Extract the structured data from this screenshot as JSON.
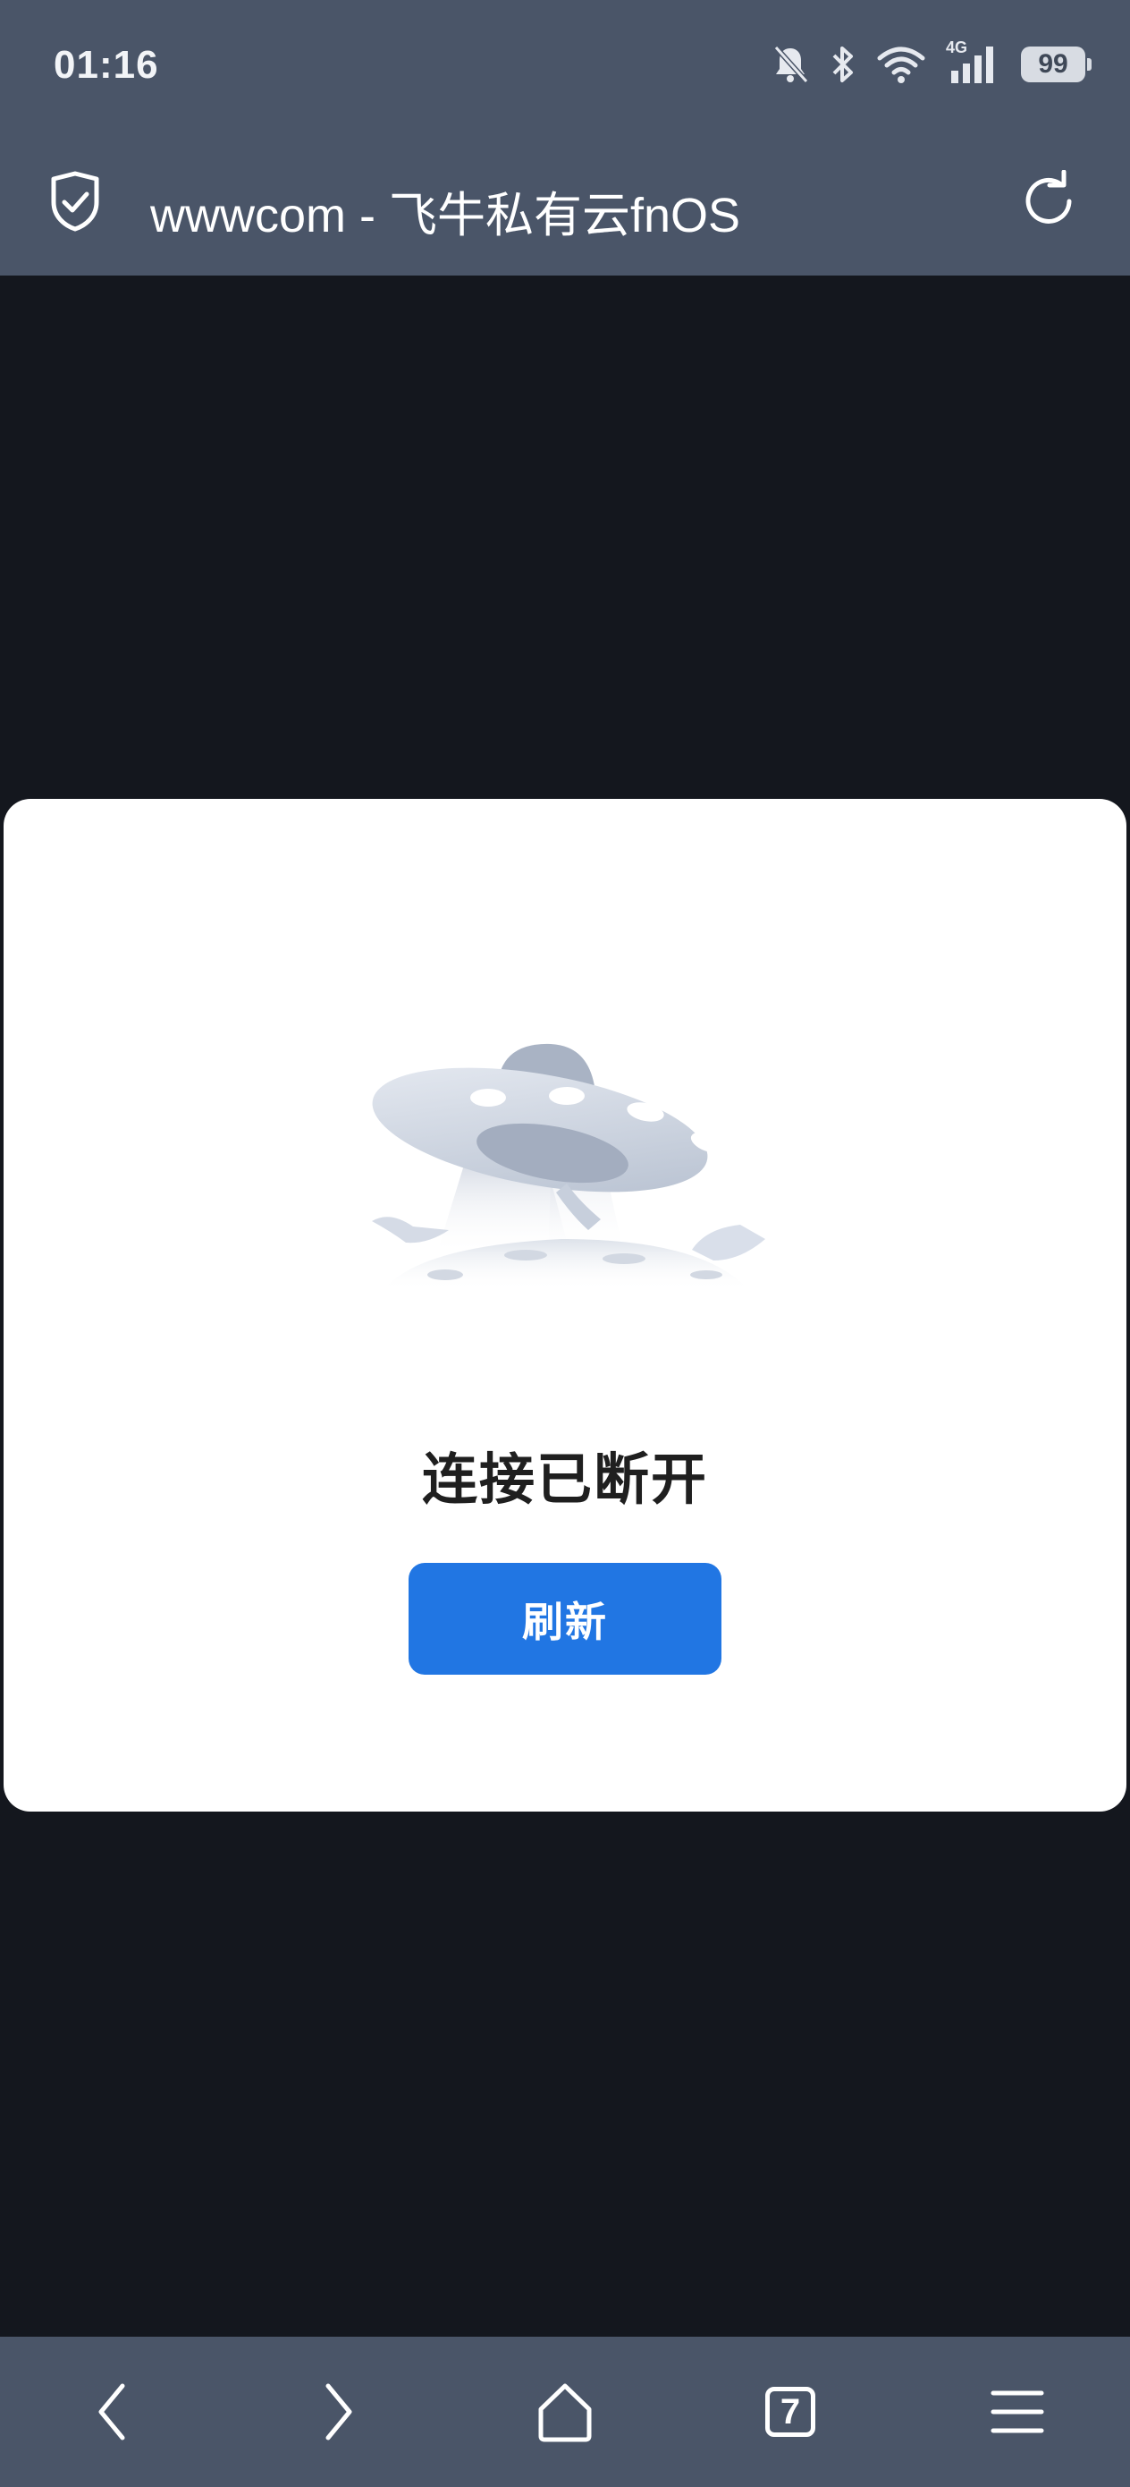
{
  "status_bar": {
    "time": "01:16",
    "network": "4G",
    "battery": "99",
    "icons": [
      "bell-off-icon",
      "bluetooth-icon",
      "wifi-icon",
      "signal-icon",
      "battery-icon"
    ]
  },
  "address_bar": {
    "title": "wwwcom - 飞牛私有云fnOS",
    "icons": [
      "shield-check-icon",
      "reload-icon"
    ]
  },
  "dialog": {
    "illustration": "ufo-illustration",
    "message": "连接已断开",
    "refresh_label": "刷新"
  },
  "bottom_nav": {
    "tabs_count": "7",
    "icons": [
      "back-icon",
      "forward-icon",
      "home-icon",
      "tabs-icon",
      "menu-icon"
    ]
  },
  "colors": {
    "chrome_bar": "#4a5568",
    "page_background": "#14171e",
    "dialog_background": "#ffffff",
    "accent_button": "#2176e3",
    "message_text": "#1f1f1f"
  }
}
